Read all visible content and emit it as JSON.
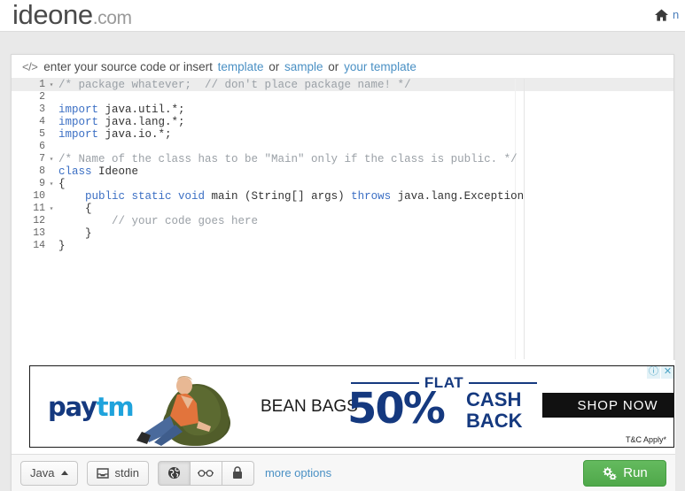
{
  "header": {
    "logo_main": "ideone",
    "logo_dot": ".",
    "logo_com": "com",
    "nav_home_icon": "home-icon",
    "nav_text": "n"
  },
  "hint_bar": {
    "code_glyph": "</>",
    "text_1": "enter your source code or insert",
    "link_template": "template",
    "text_2": "or",
    "link_sample": "sample",
    "text_3": "or",
    "link_your_template": "your template"
  },
  "editor": {
    "language_mode": "java",
    "lines": [
      {
        "num": "1",
        "fold": "▾",
        "active": true,
        "tokens": [
          {
            "t": "/* package whatever;  // don't place package name! */",
            "c": "tok-comment"
          }
        ]
      },
      {
        "num": "2",
        "fold": "",
        "tokens": []
      },
      {
        "num": "3",
        "fold": "",
        "tokens": [
          {
            "t": "import",
            "c": "tok-kw"
          },
          {
            "t": " java.util.*;",
            "c": "tok-plain"
          }
        ]
      },
      {
        "num": "4",
        "fold": "",
        "tokens": [
          {
            "t": "import",
            "c": "tok-kw"
          },
          {
            "t": " java.lang.*;",
            "c": "tok-plain"
          }
        ]
      },
      {
        "num": "5",
        "fold": "",
        "tokens": [
          {
            "t": "import",
            "c": "tok-kw"
          },
          {
            "t": " java.io.*;",
            "c": "tok-plain"
          }
        ]
      },
      {
        "num": "6",
        "fold": "",
        "tokens": []
      },
      {
        "num": "7",
        "fold": "▾",
        "tokens": [
          {
            "t": "/* Name of the class has to be \"Main\" only if the class is public. */",
            "c": "tok-comment"
          }
        ]
      },
      {
        "num": "8",
        "fold": "",
        "tokens": [
          {
            "t": "class",
            "c": "tok-kw"
          },
          {
            "t": " Ideone",
            "c": "tok-plain"
          }
        ]
      },
      {
        "num": "9",
        "fold": "▾",
        "tokens": [
          {
            "t": "{",
            "c": "tok-plain"
          }
        ]
      },
      {
        "num": "10",
        "fold": "",
        "tokens": [
          {
            "t": "    ",
            "c": "tok-plain"
          },
          {
            "t": "public static void",
            "c": "tok-kw"
          },
          {
            "t": " main (String[] args) ",
            "c": "tok-plain"
          },
          {
            "t": "throws",
            "c": "tok-kw"
          },
          {
            "t": " java.lang.Exception",
            "c": "tok-plain"
          }
        ]
      },
      {
        "num": "11",
        "fold": "▾",
        "tokens": [
          {
            "t": "    {",
            "c": "tok-plain"
          }
        ]
      },
      {
        "num": "12",
        "fold": "",
        "tokens": [
          {
            "t": "        // your code goes here",
            "c": "tok-comment"
          }
        ]
      },
      {
        "num": "13",
        "fold": "",
        "tokens": [
          {
            "t": "    }",
            "c": "tok-plain"
          }
        ]
      },
      {
        "num": "14",
        "fold": "",
        "tokens": [
          {
            "t": "}",
            "c": "tok-plain"
          }
        ]
      }
    ]
  },
  "ad": {
    "brand_pay": "pay",
    "brand_tm": "tm",
    "headline": "BEAN BAGS",
    "flat_label": "FLAT",
    "percent": "50%",
    "cash": "CASH",
    "back": "BACK",
    "cta": "SHOP NOW",
    "terms": "T&C Apply*",
    "info_icon": "ⓘ",
    "close_icon": "✕"
  },
  "toolbar": {
    "language": "Java",
    "language_caret_icon": "caret-up-icon",
    "stdin_label": "stdin",
    "stdin_icon": "inbox-icon",
    "visibility": [
      {
        "name": "public",
        "icon": "globe-icon",
        "selected": true
      },
      {
        "name": "secret",
        "icon": "glasses-icon",
        "selected": false
      },
      {
        "name": "private",
        "icon": "lock-icon",
        "selected": false
      }
    ],
    "more_options": "more options",
    "run_label": "Run",
    "run_icon": "gears-icon",
    "run_color": "#53a94e"
  }
}
